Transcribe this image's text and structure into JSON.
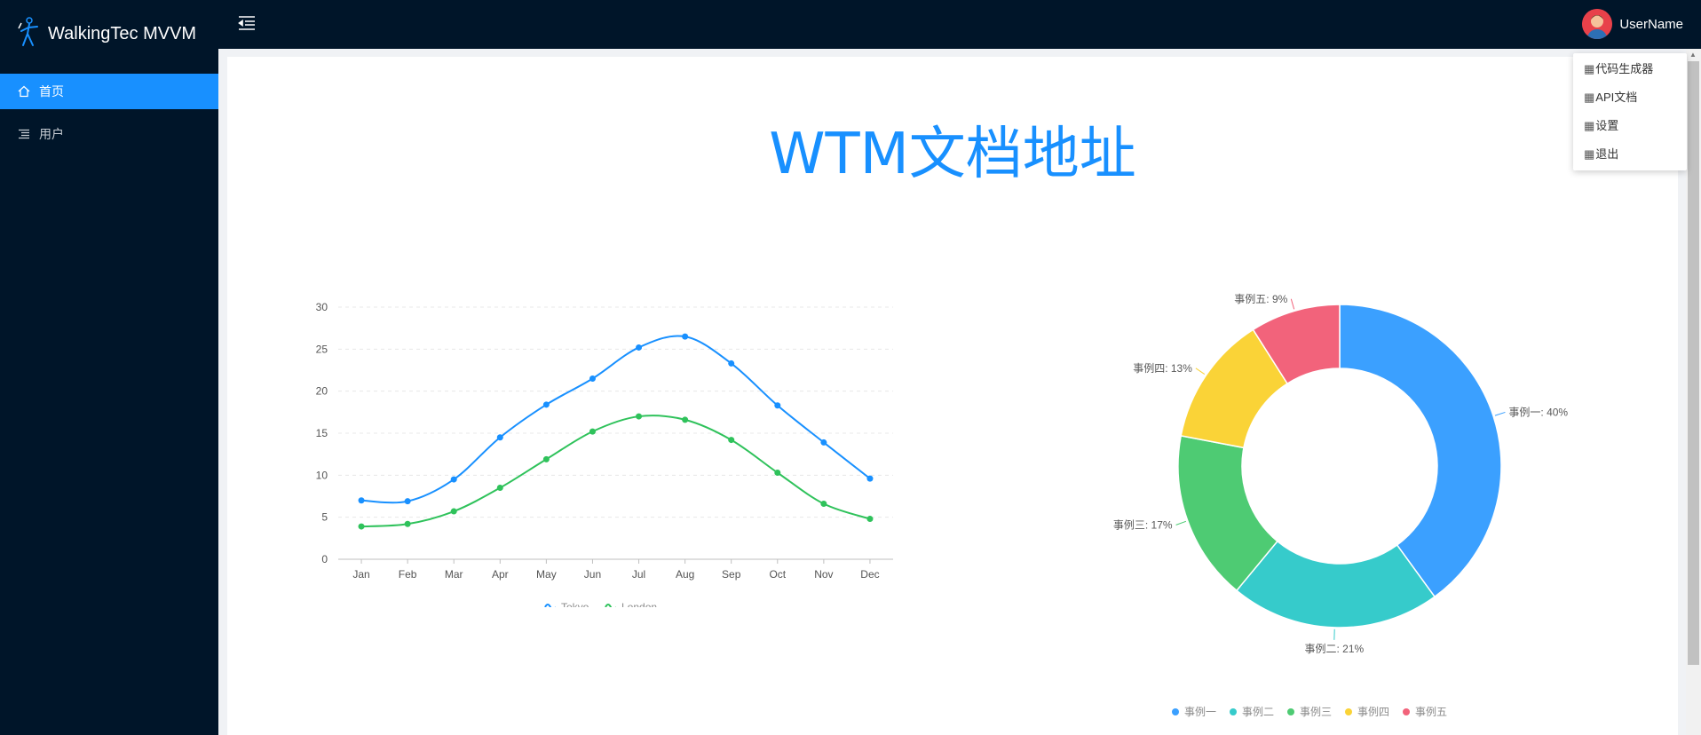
{
  "app": {
    "title": "WalkingTec MVVM"
  },
  "sidebar": {
    "items": [
      {
        "label": "首页",
        "icon": "home-icon",
        "active": true
      },
      {
        "label": "用户",
        "icon": "list-icon",
        "active": false
      }
    ]
  },
  "header": {
    "username": "UserName"
  },
  "dropdown": {
    "items": [
      {
        "label": "代码生成器"
      },
      {
        "label": "API文档"
      },
      {
        "label": "设置"
      },
      {
        "label": "退出"
      }
    ]
  },
  "main": {
    "title": "WTM文档地址"
  },
  "colors": {
    "accent": "#1890ff",
    "sidebar": "#001529"
  },
  "chart_data": [
    {
      "type": "line",
      "categories": [
        "Jan",
        "Feb",
        "Mar",
        "Apr",
        "May",
        "Jun",
        "Jul",
        "Aug",
        "Sep",
        "Oct",
        "Nov",
        "Dec"
      ],
      "series": [
        {
          "name": "Tokyo",
          "color": "#1890ff",
          "values": [
            7.0,
            6.9,
            9.5,
            14.5,
            18.4,
            21.5,
            25.2,
            26.5,
            23.3,
            18.3,
            13.9,
            9.6
          ]
        },
        {
          "name": "London",
          "color": "#2fc25b",
          "values": [
            3.9,
            4.2,
            5.7,
            8.5,
            11.9,
            15.2,
            17.0,
            16.6,
            14.2,
            10.3,
            6.6,
            4.8
          ]
        }
      ],
      "yticks": [
        0,
        5,
        10,
        15,
        20,
        25,
        30
      ],
      "ylim": [
        0,
        30
      ],
      "grid": true,
      "legend": "bottom",
      "title": "",
      "xlabel": "",
      "ylabel": ""
    },
    {
      "type": "pie",
      "donut": true,
      "slices": [
        {
          "name": "事例一",
          "value": 40,
          "color": "#3ba0ff",
          "label": "事例一: 40%"
        },
        {
          "name": "事例二",
          "value": 21,
          "color": "#36cbcb",
          "label": "事例二: 21%"
        },
        {
          "name": "事例三",
          "value": 17,
          "color": "#4ecb73",
          "label": "事例三: 17%"
        },
        {
          "name": "事例四",
          "value": 13,
          "color": "#fad337",
          "label": "事例四: 13%"
        },
        {
          "name": "事例五",
          "value": 9,
          "color": "#f2637b",
          "label": "事例五: 9%"
        }
      ],
      "legend": "bottom"
    }
  ]
}
